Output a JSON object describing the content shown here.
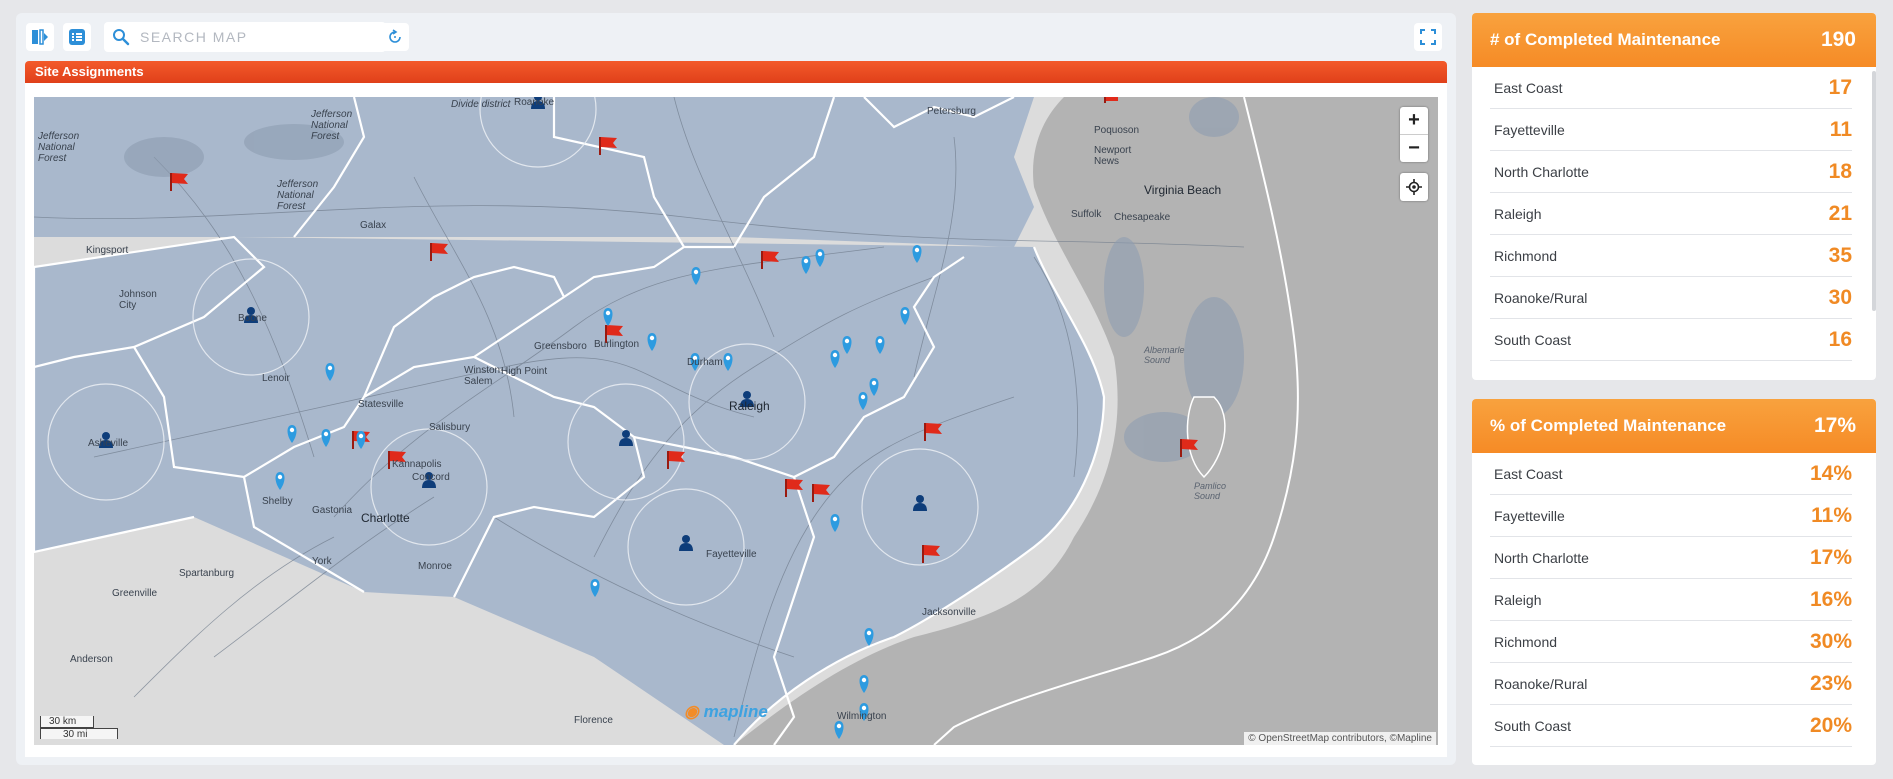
{
  "toolbar": {
    "search_placeholder": "SEARCH MAP"
  },
  "map": {
    "panel_title": "Site Assignments",
    "attribution": "© OpenStreetMap contributors, ©Mapline",
    "scale_km": "30 km",
    "scale_mi": "30 mi",
    "logo": "mapline",
    "zoom_in": "+",
    "zoom_out": "−",
    "labels": {
      "roanoke": "Roanoke",
      "petersburg": "Petersburg",
      "virginia_beach": "Virginia Beach",
      "chesapeake": "Chesapeake",
      "suffolk": "Suffolk",
      "newport_news": "Newport News",
      "poquoson": "Poquoson",
      "jefferson_nf1": "Jefferson National Forest",
      "jefferson_nf2": "Jefferson National Forest",
      "jefferson_nf3": "Jefferson National Forest",
      "divide": "Divide district",
      "galax": "Galax",
      "kingsport": "Kingsport",
      "johnson_city": "Johnson City",
      "boone": "Boone",
      "lenoir": "Lenoir",
      "winston_salem": "Winston-Salem",
      "greensboro": "Greensboro",
      "burlington": "Burlington",
      "durham": "Durham",
      "raleigh": "Raleigh",
      "high_point": "High Point",
      "statesville": "Statesville",
      "salisbury": "Salisbury",
      "kannapolis": "Kannapolis",
      "concord": "Concord",
      "asheville": "Asheville",
      "shelby": "Shelby",
      "gastonia": "Gastonia",
      "charlotte": "Charlotte",
      "monroe": "Monroe",
      "york": "York",
      "spartanburg": "Spartanburg",
      "greenville": "Greenville",
      "anderson": "Anderson",
      "fayetteville": "Fayetteville",
      "jacksonville": "Jacksonville",
      "wilmington": "Wilmington",
      "florence": "Florence",
      "albemarle": "Albemarle Sound",
      "pamlico": "Pamlico Sound"
    },
    "marker_types": [
      "flag",
      "person",
      "pin"
    ]
  },
  "count_card": {
    "title": "# of Completed Maintenance",
    "total": "190",
    "rows": [
      {
        "name": "East Coast",
        "value": "17"
      },
      {
        "name": "Fayetteville",
        "value": "11"
      },
      {
        "name": "North Charlotte",
        "value": "18"
      },
      {
        "name": "Raleigh",
        "value": "21"
      },
      {
        "name": "Richmond",
        "value": "35"
      },
      {
        "name": "Roanoke/Rural",
        "value": "30"
      },
      {
        "name": "South Coast",
        "value": "16"
      }
    ]
  },
  "pct_card": {
    "title": "% of Completed Maintenance",
    "total": "17%",
    "rows": [
      {
        "name": "East Coast",
        "value": "14%"
      },
      {
        "name": "Fayetteville",
        "value": "11%"
      },
      {
        "name": "North Charlotte",
        "value": "17%"
      },
      {
        "name": "Raleigh",
        "value": "16%"
      },
      {
        "name": "Richmond",
        "value": "30%"
      },
      {
        "name": "Roanoke/Rural",
        "value": "23%"
      },
      {
        "name": "South Coast",
        "value": "20%"
      }
    ]
  },
  "colors": {
    "accent_orange": "#f08a24",
    "header_red": "#e84a1f",
    "pin_blue": "#2d9be0",
    "person_navy": "#0e3d7a",
    "flag_red": "#e02a1a",
    "territory_fill": "#a9b8cc"
  }
}
